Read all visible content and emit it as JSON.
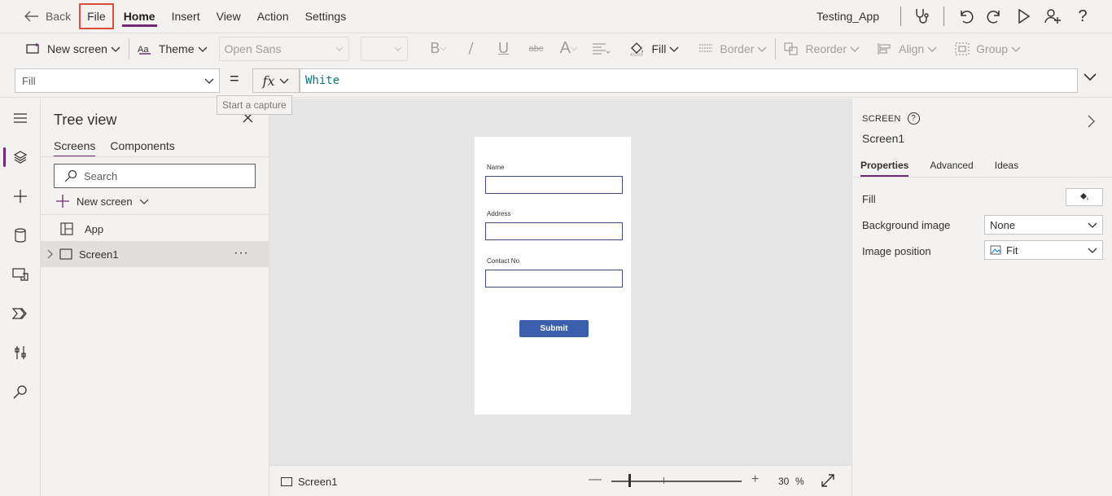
{
  "menubar": {
    "back_label": "Back",
    "items": [
      {
        "label": "File"
      },
      {
        "label": "Home"
      },
      {
        "label": "Insert"
      },
      {
        "label": "View"
      },
      {
        "label": "Action"
      },
      {
        "label": "Settings"
      }
    ],
    "active_item": "Home",
    "highlighted_item": "File",
    "app_name": "Testing_App",
    "help_label": "?"
  },
  "toolbar": {
    "new_screen_label": "New screen",
    "theme_label": "Theme",
    "font_value": "Open Sans",
    "bold_label": "B",
    "italic_label": "/",
    "underline_label": "U",
    "strike_label": "abc",
    "fontsize_label": "A",
    "fill_label": "Fill",
    "border_label": "Border",
    "reorder_label": "Reorder",
    "align_label": "Align",
    "group_label": "Group"
  },
  "formula": {
    "property": "Fill",
    "equals": "=",
    "fx_label": "fx",
    "value": "White",
    "tooltip": "Start a capture"
  },
  "tree": {
    "title": "Tree view",
    "tabs": [
      {
        "label": "Screens"
      },
      {
        "label": "Components"
      }
    ],
    "search_placeholder": "Search",
    "new_screen_label": "New screen",
    "rows": [
      {
        "label": "App"
      },
      {
        "label": "Screen1"
      }
    ],
    "more_label": "···"
  },
  "canvas": {
    "fields": [
      {
        "label": "Name"
      },
      {
        "label": "Address"
      },
      {
        "label": "Contact No"
      }
    ],
    "submit_label": "Submit"
  },
  "status": {
    "screen_label": "Screen1",
    "minus": "—",
    "plus": "+",
    "zoom_value": "30",
    "zoom_unit": "%"
  },
  "properties": {
    "kind": "SCREEN",
    "help": "?",
    "name": "Screen1",
    "tabs": [
      {
        "label": "Properties"
      },
      {
        "label": "Advanced"
      },
      {
        "label": "Ideas"
      }
    ],
    "fill_label": "Fill",
    "bg_image_label": "Background image",
    "bg_image_value": "None",
    "img_pos_label": "Image position",
    "img_pos_value": "Fit"
  },
  "colors": {
    "accent": "#742774",
    "highlight_box": "#e04e39",
    "submit_button": "#3b5fad",
    "formula_text": "#0c7b7e"
  }
}
